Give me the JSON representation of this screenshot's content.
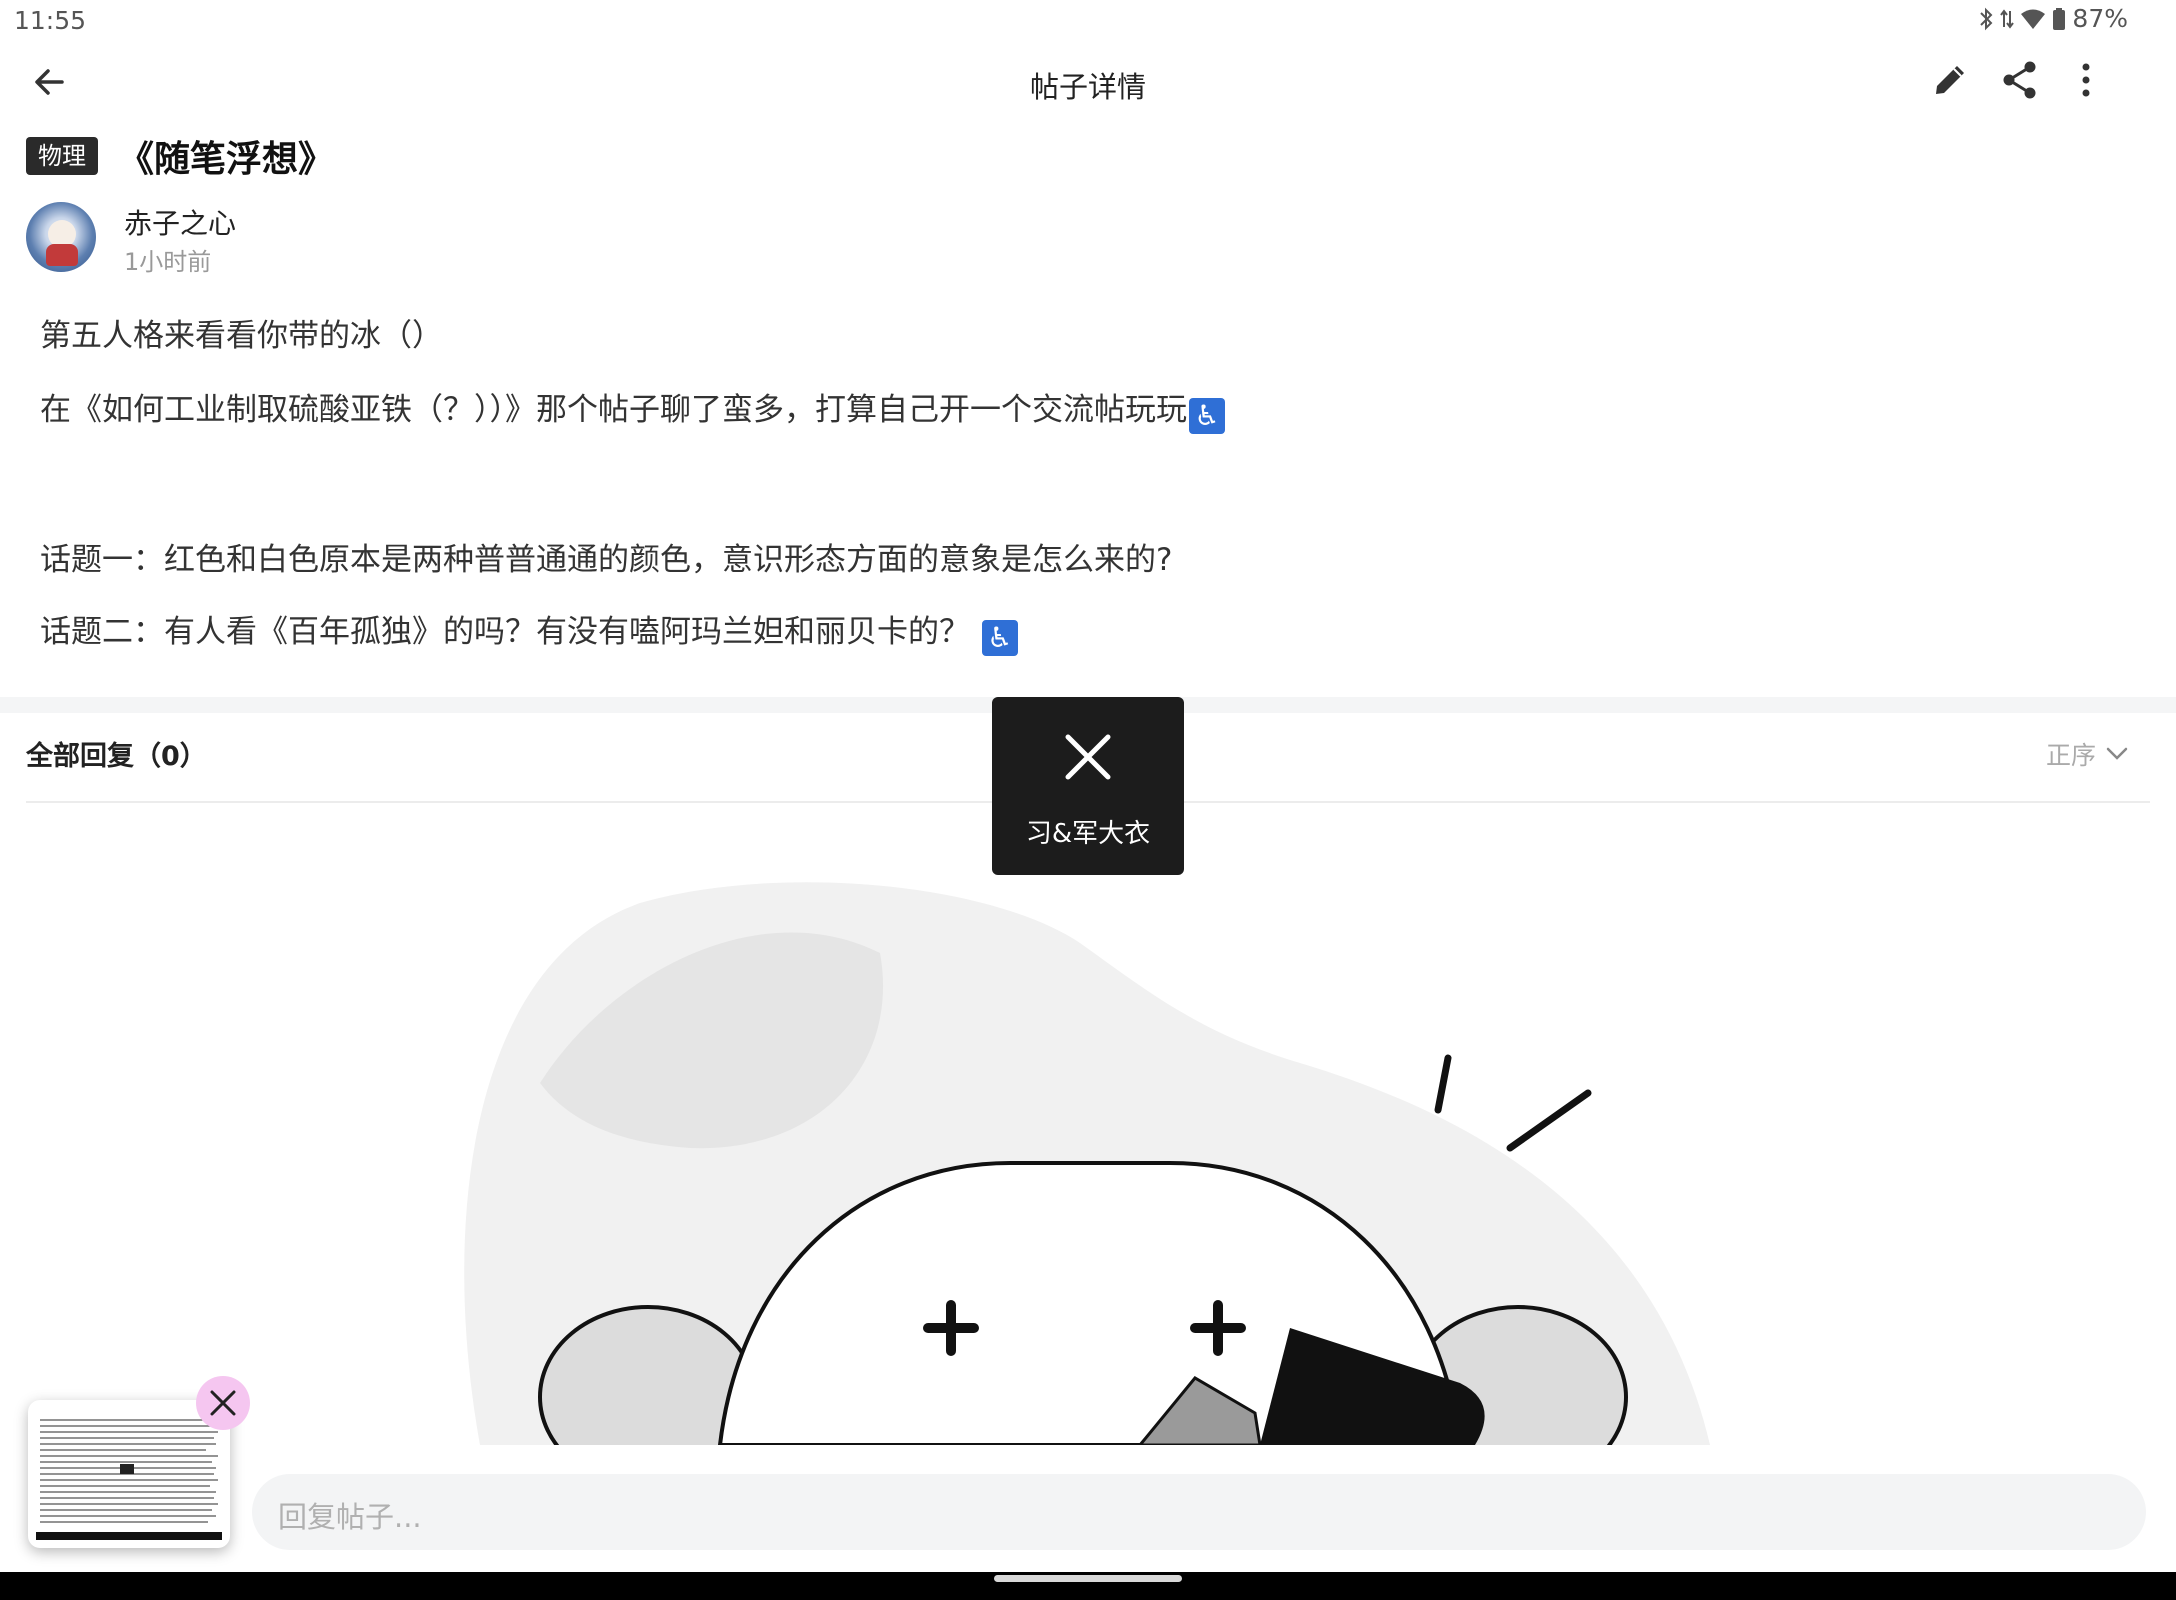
{
  "status_bar": {
    "time": "11:55",
    "battery": "87%"
  },
  "app_bar": {
    "title": "帖子详情"
  },
  "post": {
    "category": "物理",
    "title": "《随笔浮想》",
    "author": "赤子之心",
    "time_ago": "1小时前",
    "paragraphs": [
      "第五人格来看看你带的冰（）",
      "在《如何工业制取硫酸亚铁（？））》那个帖子聊了蛮多，打算自己开一个交流帖玩玩",
      "话题一：红色和白色原本是两种普普通通的颜色，意识形态方面的意象是怎么来的?",
      "话题二：有人看《百年孤独》的吗？有没有嗑阿玛兰妲和丽贝卡的？"
    ],
    "emoji": "♿"
  },
  "replies": {
    "title": "全部回复（0）",
    "sort_label": "正序"
  },
  "toast": {
    "label": "习&军大衣"
  },
  "reply_input": {
    "placeholder": "回复帖子..."
  },
  "colors": {
    "tag_bg": "#2a2a2a",
    "toast_bg": "#1c1c1c",
    "emoji_bg": "#2f6fd6",
    "thumb_close_bg": "#f5c6f0"
  }
}
